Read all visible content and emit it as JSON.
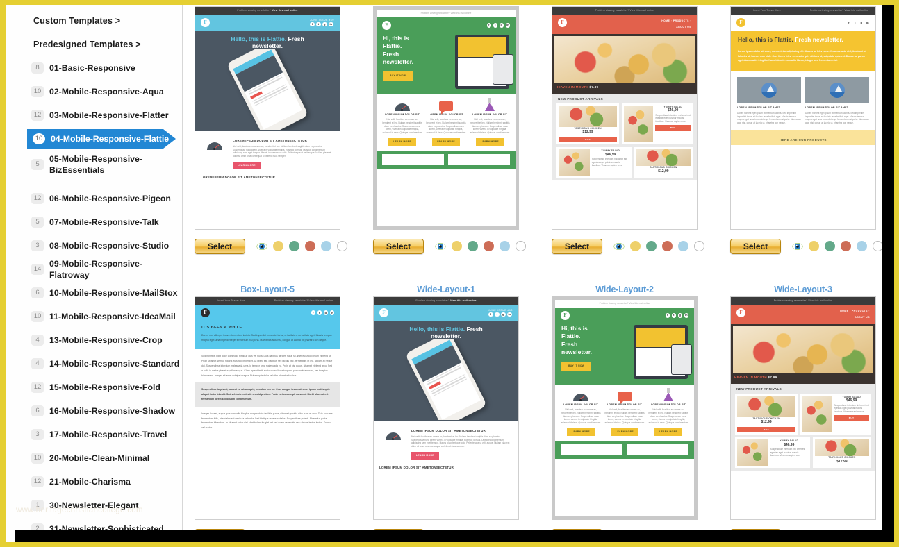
{
  "sidebar": {
    "headings": [
      {
        "label": "Custom Templates >"
      },
      {
        "label": "Predesigned Templates >"
      }
    ],
    "items": [
      {
        "count": "8",
        "label": "01-Basic-Responsive",
        "selected": false
      },
      {
        "count": "10",
        "label": "02-Mobile-Responsive-Aqua",
        "selected": false
      },
      {
        "count": "12",
        "label": "03-Mobile-Responsive-Flatter",
        "selected": false
      },
      {
        "count": "10",
        "label": "04-Mobile-Responsive-Flattie",
        "selected": true
      },
      {
        "count": "5",
        "label": "05-Mobile-Responsive-BizEssentials",
        "selected": false,
        "tall": true
      },
      {
        "count": "12",
        "label": "06-Mobile-Responsive-Pigeon",
        "selected": false
      },
      {
        "count": "5",
        "label": "07-Mobile-Responsive-Talk",
        "selected": false
      },
      {
        "count": "3",
        "label": "08-Mobile-Responsive-Studio",
        "selected": false
      },
      {
        "count": "14",
        "label": "09-Mobile-Responsive-Flatroway",
        "selected": false
      },
      {
        "count": "6",
        "label": "10-Mobile-Responsive-MailStox",
        "selected": false
      },
      {
        "count": "10",
        "label": "11-Mobile-Responsive-IdeaMail",
        "selected": false
      },
      {
        "count": "4",
        "label": "13-Mobile-Responsive-Crop",
        "selected": false
      },
      {
        "count": "4",
        "label": "14-Mobile-Responsive-Standard",
        "selected": false
      },
      {
        "count": "12",
        "label": "15-Mobile-Responsive-Fold",
        "selected": false
      },
      {
        "count": "6",
        "label": "16-Mobile-Responsive-Shadow",
        "selected": false
      },
      {
        "count": "3",
        "label": "17-Mobile-Responsive-Travel",
        "selected": false
      },
      {
        "count": "10",
        "label": "20-Mobile-Clean-Minimal",
        "selected": false
      },
      {
        "count": "12",
        "label": "21-Mobile-Charisma",
        "selected": false
      },
      {
        "count": "1",
        "label": "30-Newsletter-Elegant",
        "selected": false
      },
      {
        "count": "2",
        "label": "31-Newsletter-Sophisticated",
        "selected": false
      }
    ],
    "watermark": "www.heritagechristiancollege.com"
  },
  "gallery": {
    "select_label": "Select",
    "swatch_colors": [
      "#eed06a",
      "#63a98a",
      "#cd6d57",
      "#a8d2e8",
      "#ffffff"
    ],
    "preview_icon": "eye-icon",
    "accent_blue": "#5b9bd5",
    "row1": [
      {
        "title": "",
        "kind": "flattie-dark"
      },
      {
        "title": "",
        "kind": "flattie-green"
      },
      {
        "title": "",
        "kind": "flattie-food"
      },
      {
        "title": "",
        "kind": "flattie-yellow"
      }
    ],
    "row2": [
      {
        "title": "Box-Layout-5",
        "kind": "box-layout-5"
      },
      {
        "title": "Wide-Layout-1",
        "kind": "flattie-dark"
      },
      {
        "title": "Wide-Layout-2",
        "kind": "flattie-green"
      },
      {
        "title": "Wide-Layout-3",
        "kind": "flattie-food"
      }
    ]
  },
  "templates": {
    "flattie_dark": {
      "preheader_plain": "Problem viewing newsletter?",
      "preheader_link": "View this mail online",
      "logo": "F",
      "issue": "JUNE ISSUE #10",
      "hero_line1": "Hello, this is Flattie.",
      "hero_line2": "Fresh",
      "hero_line3": "newsletter.",
      "article_title": "LOREM IPSUM DOLOR SIT AMETONSECTETUR",
      "article_body": "Nisl velit, faucibus eu ornare ac, hendrerit et leo. Nullam hendrerit sagittis diam eu pharetra. Suspendisse nunc lorem, viverra in vulputate fringilla, euismod id risus. Quisque condimentum adipiscing sem eget tempor. Mauris id scelerisque odio. Pellentesque ut velit augue. Nullam placerat dolor sit amet urna consequat a eleifend risus semper.",
      "cta": "LEARN MORE",
      "article_title2": "LOREM IPSUM DOLOR SIT AMETONSECTETUR"
    },
    "flattie_green": {
      "preheader": "Problem viewing newsletter? View this mail online",
      "logo": "F",
      "hero_line1": "Hi, this is",
      "hero_line2": "Flattie.",
      "hero_line3": "Fresh",
      "hero_line4": "newsletter.",
      "cta_hero": "BUY IT NOW",
      "columns": [
        {
          "title": "LOREM IPSUM DOLOR SIT",
          "body": "Nisl velit, faucibus eu ornare ac, hendrerit et leo. Nullam hendrerit sagittis diam eu pharetra. Suspendisse nunc lorem, viverra in vulputate fringilla, euismod id risus. Quisque condimentum",
          "cta": "LEARN MORE",
          "icon": "gauge-icon"
        },
        {
          "title": "LOREM IPSUM DOLOR SIT",
          "body": "Nisl velit, faucibus eu ornare ac, hendrerit et leo. Nullam hendrerit sagittis diam eu pharetra. Suspendisse nunc lorem, viverra in vulputate fringilla, euismod id risus. Quisque condimentum",
          "cta": "LEARN MORE",
          "icon": "chat-icon"
        },
        {
          "title": "LOREM IPSUM DOLOR SIT",
          "body": "Nisl velit, faucibus eu ornare ac, hendrerit et leo. Nullam hendrerit sagittis diam eu pharetra. Suspendisse nunc lorem, viverra in vulputate fringilla, euismod id risus. Quisque condimentum",
          "cta": "LEARN MORE",
          "icon": "flask-icon"
        }
      ]
    },
    "flattie_food": {
      "preheader": "Problem viewing newsletter? View this mail online",
      "logo": "F",
      "nav": [
        "HOME",
        "PRODUCTS",
        "ABOUT US"
      ],
      "hero_caption": "HEAVEN IN MOUTH",
      "hero_price": "$7.99",
      "section_title": "NEW PRODUCT ARRIVALS",
      "products": [
        {
          "name": "TASTICIOUS CHICKEN",
          "price": "$12,99",
          "cta": "BUY"
        },
        {
          "name": "YUMMY SALAD",
          "price": "$46,99",
          "cta": "BUY",
          "body": "Suspendisse interdum nisl amet est egestas eget pulvinar mauris faucibus. Vivamus sapien eros"
        },
        {
          "name": "YUMMY SALAD",
          "price": "$46,99",
          "cta": "BUY",
          "body": "Suspendisse interdum nisl amet est egestas eget pulvinar mauris faucibus. Vivamus sapien eros"
        },
        {
          "name": "TASTICIOUS CHICKEN",
          "price": "$12,99",
          "cta": "BUY"
        }
      ]
    },
    "flattie_yellow": {
      "preheader_left": "Insert Your Teaser Here",
      "preheader_right": "Problem viewing newsletter? View this mail online",
      "logo": "F",
      "hero_line1": "Hello, this is Flattie.",
      "hero_accent": "Fresh",
      "hero_line2": "newsletter.",
      "hero_body": "Lorem ipsum dolor sit amet, consectetur adipiscing elit. Mauris ac felis nunc. Vivamus ante nisl, tincidunt ut lobortis at, laoreet non nibh. Cras libero felis, venenatis quis ultrices id, vulputate quis est. Donec ac purus eget diam mattis fringilla. Nunc lobortis convallis libero, integer sed fermentum nisl.",
      "cards": [
        {
          "title": "LOREM IPSUM DOLOR SIT AMET",
          "body": "Donec non elit eget ipsum elementum lacinia. Sed imperdiet imperdiet tortor, et facilisis urna facilisis eget. Mauris tempus magna eget urna imperdiet eget fermentum nisi porta. Maecenas arcu nisi, conue at lacinia ut, pharetra non neque."
        },
        {
          "title": "LOREM IPSUM DOLOR SIT AMET",
          "body": "Donec non elit eget ipsum elementum lacinia. Sed imperdiet imperdiet tortor, et facilisis urna facilisis eget. Mauris tempus magna eget urna imperdiet eget fermentum nisi porta. Maecenas arcu nisi, conue at lacinia ut, pharetra non neque."
        }
      ],
      "footer_band": "HERE ARE OUR PRODUCTS"
    },
    "box_layout_5": {
      "preheader_left": "Insert Your Teaser Here",
      "preheader_right": "Problem viewing newsletter? View this mail online",
      "logo": "F",
      "heading": "IT'S BEEN A WHILE ..",
      "intro": "Donec non elit eget ipsum elementum lacinia. Sed imperdiet imperdiet tortor, et facilisis urna facilisis eget. Mauris tempus magna eget urna imperdiet eget fermentum nisi porta. Maecenas arcu nisi, congue at lacinia ut, pharetra non neque.",
      "para1": "Sed non felis eget dolor commodo tristique quis vel nulla. Duis dapibus ultrices nulla, sit amet euismod ipsum eleifend ut. Proin sit amet sem ut mauris euismod imperdiet. Ut libero est, dapibus nec iaculis nec, fermentum et leo. Nullam at neque dui. Suspendisse interdum malesuada urna, id tempor urna malesuada eu. Proin at nisi purus, sit amet eleifend arcu. Sed a nulla id metus pharetra pellentesque. Class aptent taciti sociosqu ad litora torquent per conubia nostra, per inceptos himenaeos. Integer sit amet volutpat magna. Nullam quis dolor vel nibh pharetra facilisis.",
      "para_bold": "Suspendisse turpis mi, laoreet eu rutrum quis, interdum nec mi. Cras congue ipsum sit amet ipsum mattis quis aliquet tortor blandit. Sed vehicula molestie eros id pretium. Proin varius suscipit euismod. Morbi placerat est fermentum lorem sollicitudin condimentum.",
      "para2": "Integer laoreet, augue quis convallis fringilla, magna dolor facilisis purus, sit amet gravida nibh nunc et arcu. Duis posuere fermentum felis, at sodales est vehicula vehicula. Sed tristique ornare sodales. Suspendisse potenti. Phasellus porta fermentum bibendum. In sit amet tortor nisi. Vestibulum feugiat est sed quam venenatis nec ultrices lectus luctus. Donec vel auctor"
    }
  }
}
